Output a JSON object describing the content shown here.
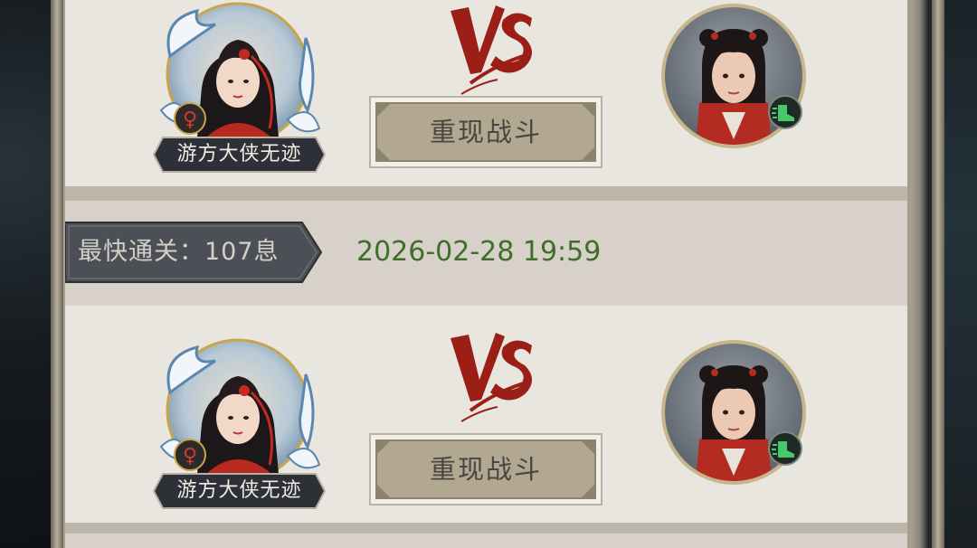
{
  "battles": [
    {
      "player_name": "游方大侠无迹",
      "player_gender_symbol": "♀",
      "vs_label": "VS",
      "replay_label": "重现战斗",
      "opponent_badge_icon": "speed-boots-icon"
    },
    {
      "player_name": "游方大侠无迹",
      "player_gender_symbol": "♀",
      "vs_label": "VS",
      "replay_label": "重现战斗",
      "opponent_badge_icon": "speed-boots-icon"
    }
  ],
  "record": {
    "fastest_clear_label": "最快通关：107息",
    "date": "2026-02-28 19:59"
  },
  "colors": {
    "date_green": "#3f6e28",
    "vs_red": "#9b1f17",
    "card_bg": "#e9e5df",
    "plate_dark": "#2d3036"
  }
}
